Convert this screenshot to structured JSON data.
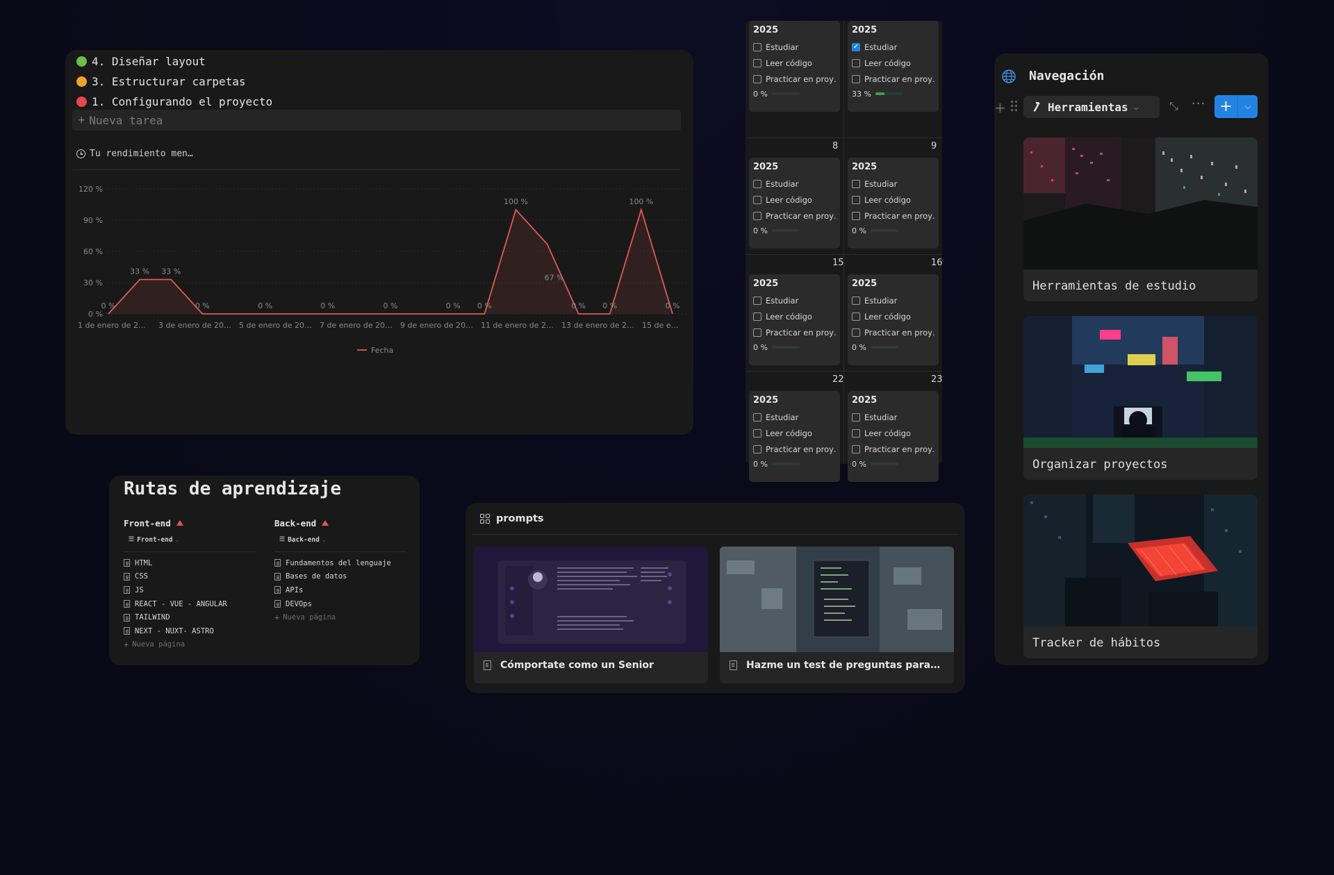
{
  "tasks": {
    "items": [
      {
        "label": "4. Diseñar layout",
        "color": "#6abf45"
      },
      {
        "label": "3. Estructurar carpetas",
        "color": "#f2a02f"
      },
      {
        "label": "1. Configurando el proyecto",
        "color": "#e5484d"
      }
    ],
    "new_task_label": "Nueva tarea"
  },
  "chart_data": {
    "type": "area",
    "title": "Tu rendimiento men…",
    "color": "#e05a55",
    "ylim": [
      0,
      120
    ],
    "y_ticks": [
      "0 %",
      "30 %",
      "60 %",
      "90 %",
      "120 %"
    ],
    "x_tick_labels": [
      "1 de enero de 2…",
      "3 de enero de 20…",
      "5 de enero de 20…",
      "7 de enero de 20…",
      "9 de enero de 20…",
      "11 de enero de 2…",
      "13 de enero de 2…",
      "15 de e…"
    ],
    "legend": "Fecha",
    "legend_position": "bottom",
    "series": [
      {
        "name": "Fecha",
        "values": [
          0,
          33,
          33,
          0,
          0,
          0,
          0,
          0,
          0,
          0,
          0,
          0,
          0,
          100,
          67,
          0,
          0,
          100,
          0
        ],
        "labels": [
          "0 %",
          "33 %",
          "33 %",
          "0 %",
          "",
          "0 %",
          "",
          "0 %",
          "",
          "0 %",
          "",
          "0 %",
          "0 %",
          "100 %",
          "67 %",
          "0 %",
          "0 %",
          "100 %",
          "0 %"
        ]
      }
    ]
  },
  "calendar": {
    "check_labels": [
      "Estudiar",
      "Leer código",
      "Practicar en proy…"
    ],
    "rows": [
      {
        "left_day": "",
        "right_day": "",
        "left": {
          "year": "2025",
          "checks": [
            false,
            false,
            false
          ],
          "progress_label": "0 %",
          "progress": 0
        },
        "right": {
          "year": "2025",
          "checks": [
            true,
            false,
            false
          ],
          "progress_label": "33 %",
          "progress": 0.33
        }
      },
      {
        "left_day": "8",
        "right_day": "9",
        "left": {
          "year": "2025",
          "checks": [
            false,
            false,
            false
          ],
          "progress_label": "0 %",
          "progress": 0
        },
        "right": {
          "year": "2025",
          "checks": [
            false,
            false,
            false
          ],
          "progress_label": "0 %",
          "progress": 0
        }
      },
      {
        "left_day": "15",
        "right_day": "16",
        "left": {
          "year": "2025",
          "checks": [
            false,
            false,
            false
          ],
          "progress_label": "0 %",
          "progress": 0
        },
        "right": {
          "year": "2025",
          "checks": [
            false,
            false,
            false
          ],
          "progress_label": "0 %",
          "progress": 0
        }
      },
      {
        "left_day": "22",
        "right_day": "23",
        "left": {
          "year": "2025",
          "checks": [
            false,
            false,
            false
          ],
          "progress_label": "0 %",
          "progress": 0
        },
        "right": {
          "year": "2025",
          "checks": [
            false,
            false,
            false
          ],
          "progress_label": "0 %",
          "progress": 0
        }
      }
    ]
  },
  "navigation": {
    "title": "Navegación",
    "view_tab_label": "Herramientas",
    "cards": [
      {
        "label": "Herramientas de estudio"
      },
      {
        "label": "Organizar proyectos"
      },
      {
        "label": "Tracker de hábitos"
      }
    ]
  },
  "routes": {
    "title": "Rutas de aprendizaje",
    "columns": [
      {
        "heading": "Front-end",
        "view_label": "Front-end",
        "items": [
          "HTML",
          "CSS",
          "JS",
          "REACT - VUE - ANGULAR",
          "TAILWIND",
          "NEXT - NUXT- ASTRO"
        ],
        "new_label": "Nueva página"
      },
      {
        "heading": "Back-end",
        "view_label": "Back-end",
        "items": [
          "Fundamentos del lenguaje",
          "Bases de datos",
          "APIs",
          "DEVOps"
        ],
        "new_label": "Nueva página"
      }
    ]
  },
  "prompts": {
    "title": "prompts",
    "cards": [
      {
        "label": "Cómportate como un Senior"
      },
      {
        "label": "Hazme un test de preguntas para…"
      }
    ]
  }
}
